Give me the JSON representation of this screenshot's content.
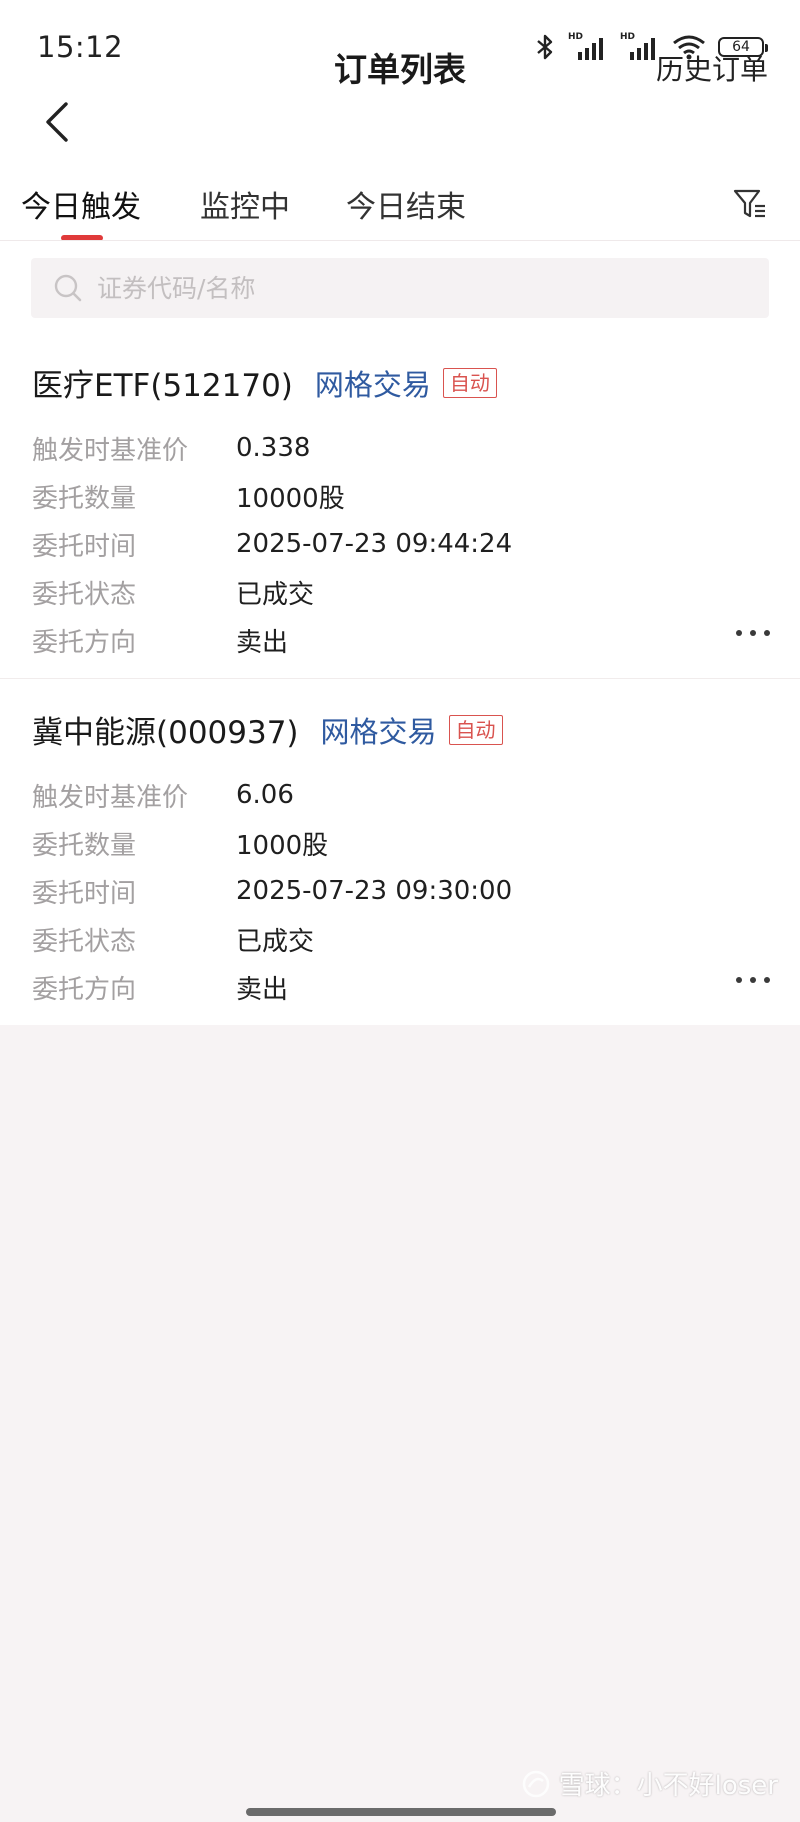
{
  "status_bar": {
    "time": "15:12",
    "battery": "64",
    "sim_badge": "HD"
  },
  "nav": {
    "title": "订单列表",
    "history": "历史订单"
  },
  "tabs": [
    {
      "label": "今日触发",
      "active": true
    },
    {
      "label": "监控中",
      "active": false
    },
    {
      "label": "今日结束",
      "active": false
    }
  ],
  "search": {
    "placeholder": "证券代码/名称"
  },
  "orders": [
    {
      "name": "医疗ETF(512170)",
      "strategy": "网格交易",
      "badge": "自动",
      "fields": [
        {
          "label": "触发时基准价",
          "value": "0.338"
        },
        {
          "label": "委托数量",
          "value": "10000股"
        },
        {
          "label": "委托时间",
          "value": "2025-07-23 09:44:24"
        },
        {
          "label": "委托状态",
          "value": "已成交"
        },
        {
          "label": "委托方向",
          "value": "卖出"
        }
      ]
    },
    {
      "name": "冀中能源(000937)",
      "strategy": "网格交易",
      "badge": "自动",
      "fields": [
        {
          "label": "触发时基准价",
          "value": "6.06"
        },
        {
          "label": "委托数量",
          "value": "1000股"
        },
        {
          "label": "委托时间",
          "value": "2025-07-23 09:30:00"
        },
        {
          "label": "委托状态",
          "value": "已成交"
        },
        {
          "label": "委托方向",
          "value": "卖出"
        }
      ]
    }
  ],
  "watermark": "雪球：小不好loser",
  "colors": {
    "accent_red": "#e03a3a",
    "strategy_blue": "#2f5aa0",
    "badge_red": "#d9534f",
    "label_gray": "#a3a0a1",
    "page_bg": "#f7f3f4"
  }
}
